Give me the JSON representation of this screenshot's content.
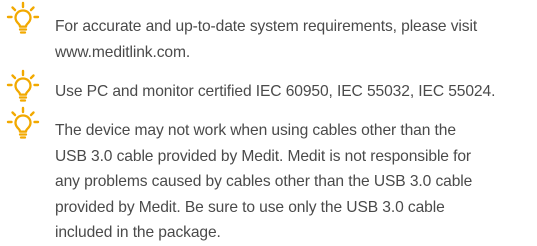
{
  "notes": [
    {
      "icon": "lightbulb-tip-icon",
      "text": "For accurate and up-to-date system requirements, please visit\nwww.meditlink.com."
    },
    {
      "icon": "lightbulb-tip-icon",
      "text": "Use PC and monitor certified IEC 60950, IEC 55032, IEC 55024."
    },
    {
      "icon": "lightbulb-tip-icon",
      "text": "The device may not work when using cables other than the\nUSB 3.0 cable provided by Medit. Medit is not responsible for\nany problems caused by cables other than the USB 3.0 cable\nprovided by Medit. Be sure to use only the USB 3.0 cable\nincluded in the package."
    }
  ],
  "colors": {
    "icon_accent": "#f2a900",
    "text": "#4a4a4a"
  }
}
